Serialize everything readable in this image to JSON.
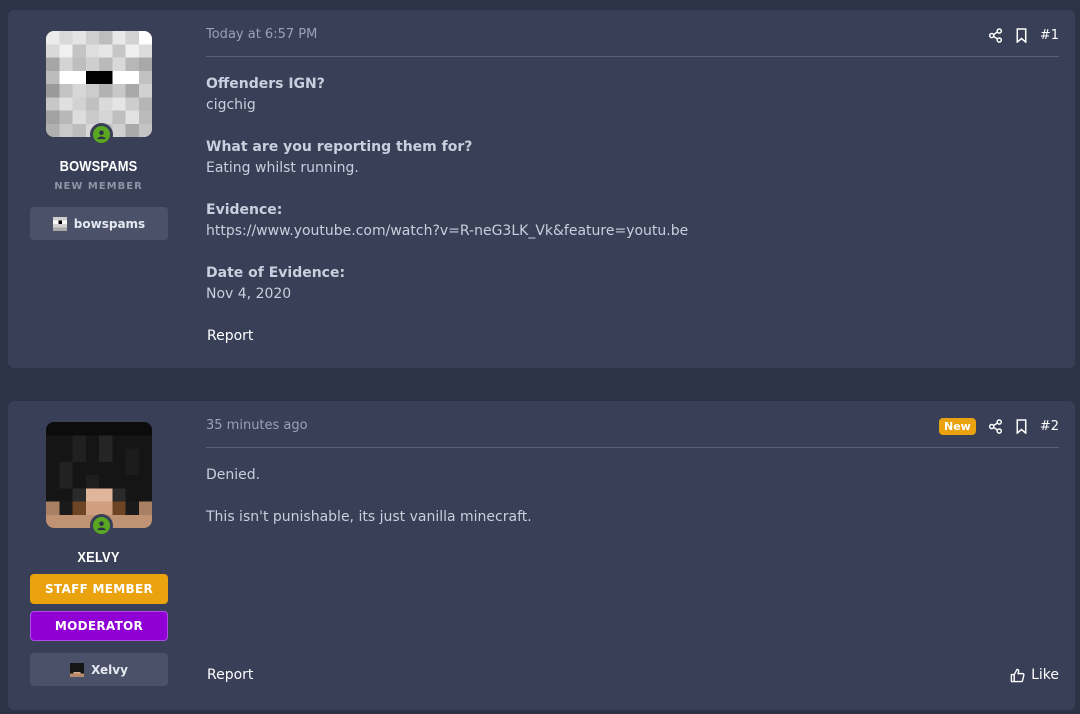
{
  "posts": [
    {
      "user": {
        "name": "BOWSPAMS",
        "title": "NEW MEMBER",
        "ign": "bowspams"
      },
      "time": "Today at 6:57 PM",
      "number": "#1",
      "fields": [
        {
          "q": "Offenders IGN?",
          "a": "cigchig"
        },
        {
          "q": "What are you reporting them for?",
          "a": "Eating whilst running."
        },
        {
          "q": "Evidence:",
          "a": "https://www.youtube.com/watch?v=R-neG3LK_Vk&feature=youtu.be"
        },
        {
          "q": "Date of Evidence:",
          "a": "Nov 4, 2020"
        }
      ],
      "report_label": "Report"
    },
    {
      "user": {
        "name": "XELVY",
        "banners": [
          "STAFF MEMBER",
          "MODERATOR"
        ],
        "ign": "Xelvy"
      },
      "time": "35 minutes ago",
      "badge": "New",
      "number": "#2",
      "lines": [
        "Denied.",
        "This isn't punishable, its just vanilla minecraft."
      ],
      "report_label": "Report",
      "like_label": "Like"
    }
  ],
  "icons": {
    "share": "share-icon",
    "bookmark": "bookmark-icon",
    "like": "thumbs-up-icon",
    "online": "online-user-icon"
  },
  "colors": {
    "background": "#2c3347",
    "card": "#383f56",
    "staff": "#eaa20e",
    "moderator": "#9000d4",
    "online": "#5aa821"
  }
}
